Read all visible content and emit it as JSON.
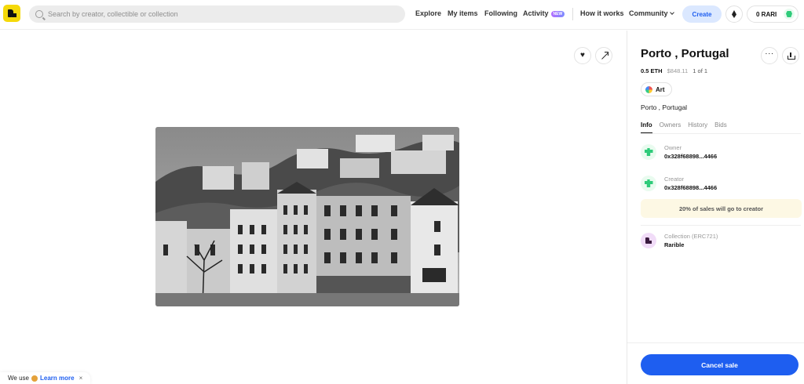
{
  "header": {
    "search_placeholder": "Search by creator, collectible or collection",
    "nav": {
      "explore": "Explore",
      "my_items": "My items",
      "following": "Following",
      "activity": "Activity",
      "activity_badge": "NEW",
      "how_it_works": "How it works",
      "community": "Community"
    },
    "create_label": "Create",
    "wallet_balance": "0 RARI"
  },
  "cookie_banner": {
    "text": "We use",
    "link": "Learn more",
    "close": "×"
  },
  "item": {
    "title": "Porto , Portugal",
    "price_eth": "0.5 ETH",
    "price_usd": "$848.11",
    "edition": "1 of 1",
    "category": "Art",
    "description": "Porto , Portugal",
    "tabs": [
      "Info",
      "Owners",
      "History",
      "Bids"
    ],
    "owner": {
      "label": "Owner",
      "value": "0x328f68898...4466"
    },
    "creator": {
      "label": "Creator",
      "value": "0x328f68898...4466"
    },
    "royalty_note": "20% of sales will go to creator",
    "collection": {
      "label": "Collection (ERC721)",
      "value": "Rarible"
    },
    "cancel_label": "Cancel sale"
  }
}
